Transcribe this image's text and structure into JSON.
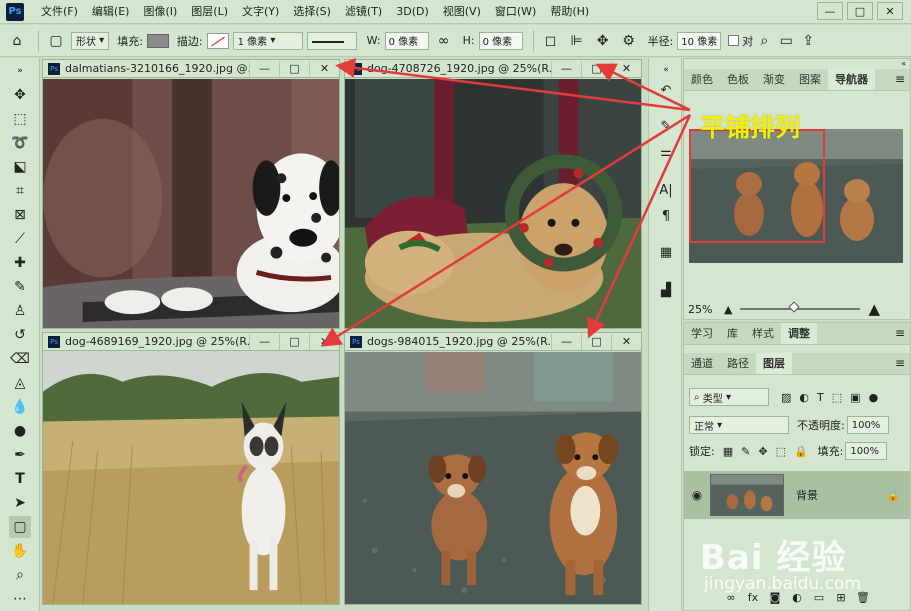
{
  "app": {
    "logo": "Ps",
    "menu": [
      "文件(F)",
      "编辑(E)",
      "图像(I)",
      "图层(L)",
      "文字(Y)",
      "选择(S)",
      "滤镜(T)",
      "3D(D)",
      "视图(V)",
      "窗口(W)",
      "帮助(H)"
    ],
    "window_controls": [
      "—",
      "□",
      "✕"
    ]
  },
  "options": {
    "home_icon": "home-icon",
    "shape_mode": "形状",
    "fill_label": "填充:",
    "stroke_label": "描边:",
    "stroke_width": "1 像素",
    "w_label": "W:",
    "w_value": "0 像素",
    "h_label": "H:",
    "h_value": "0 像素",
    "radius_label": "半径:",
    "radius_value": "10 像素",
    "align_edges_label": "对"
  },
  "documents": [
    {
      "title": "dalmatians-3210166_1920.jpg @...",
      "buttons": [
        "—",
        "□",
        "✕"
      ]
    },
    {
      "title": "dog-4708726_1920.jpg @ 25%(R...",
      "buttons": [
        "—",
        "□",
        "✕"
      ]
    },
    {
      "title": "dog-4689169_1920.jpg @ 25%(R...",
      "buttons": [
        "—",
        "□",
        "✕"
      ]
    },
    {
      "title": "dogs-984015_1920.jpg @ 25%(R...",
      "buttons": [
        "—",
        "□",
        "✕"
      ]
    }
  ],
  "nav_panel": {
    "tabs": [
      "颜色",
      "色板",
      "渐变",
      "图案",
      "导航器"
    ],
    "active_tab": "导航器",
    "zoom": "25%",
    "zoom_fraction": 0.45
  },
  "layers_panel": {
    "top_tabs": [
      "学习",
      "库",
      "样式",
      "调整"
    ],
    "sub_tabs": [
      "通道",
      "路径",
      "图层"
    ],
    "filter_kind": "类型",
    "blend_mode": "正常",
    "opacity_label": "不透明度:",
    "opacity": "100%",
    "lock_label": "锁定:",
    "fill_label": "填充:",
    "fill": "100%",
    "layer_name": "背景"
  },
  "annotation": {
    "callout": "平铺排列",
    "color": "#f3f000",
    "arrow_color": "#e53a3a"
  },
  "watermark": {
    "brand": "Bai 经验",
    "url": "jingyan.baidu.com"
  }
}
